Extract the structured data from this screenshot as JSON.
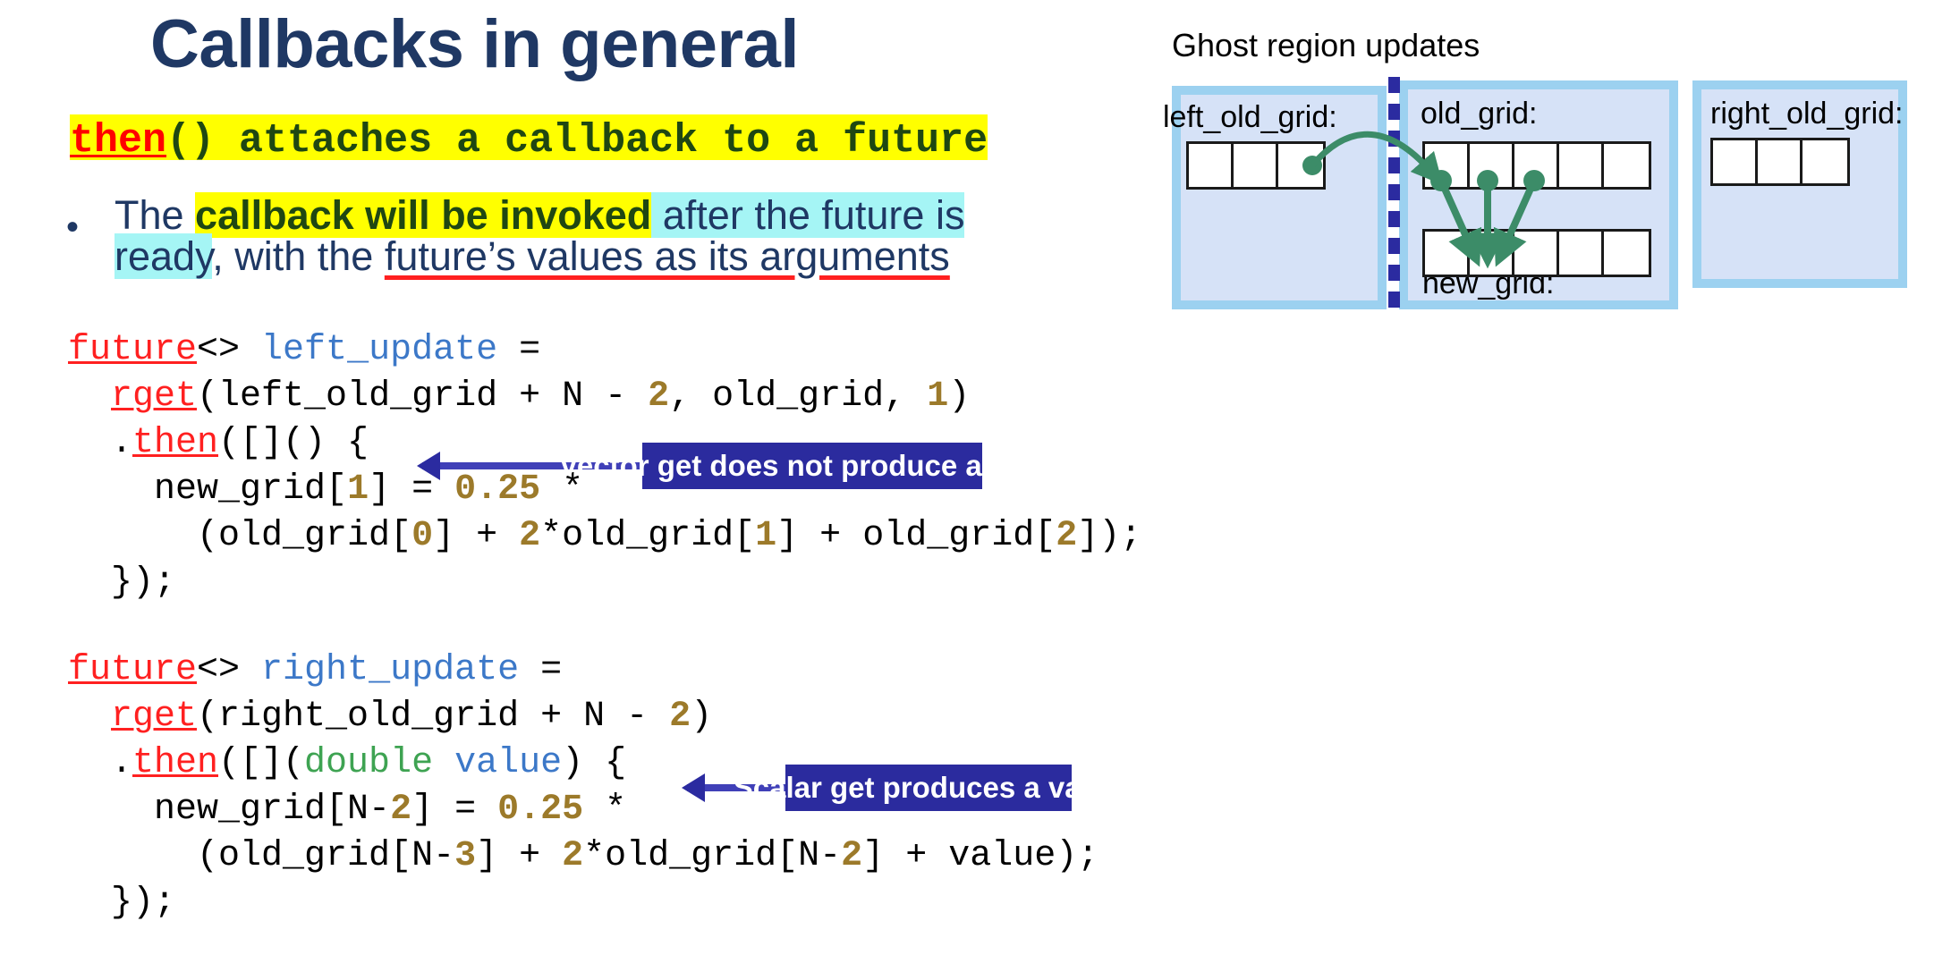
{
  "slide": {
    "title": "Callbacks in general"
  },
  "lead": {
    "keyword": "then",
    "rest": "() attaches a callback to a future"
  },
  "bullet": {
    "marker": "•",
    "line1_a": "The ",
    "line1_b": "callback will be invoked",
    "line1_c": " after the future is",
    "line2_a": "ready",
    "line2_b": ", with the ",
    "line2_c": "future’s values as its arguments"
  },
  "code_left": {
    "lines": [
      [
        {
          "t": "future",
          "c": "kw"
        },
        {
          "t": "<> ",
          "c": "op"
        },
        {
          "t": "left_update",
          "c": "var"
        },
        {
          "t": " =",
          "c": "op"
        }
      ],
      [
        {
          "t": "  ",
          "c": "op"
        },
        {
          "t": "rget",
          "c": "kw"
        },
        {
          "t": "(left_old_grid + N - ",
          "c": "op"
        },
        {
          "t": "2",
          "c": "num"
        },
        {
          "t": ", old_grid, ",
          "c": "op"
        },
        {
          "t": "1",
          "c": "num"
        },
        {
          "t": ")",
          "c": "op"
        }
      ],
      [
        {
          "t": "  .",
          "c": "op"
        },
        {
          "t": "then",
          "c": "kw"
        },
        {
          "t": "([]() {",
          "c": "op"
        }
      ],
      [
        {
          "t": "    new_grid[",
          "c": "op"
        },
        {
          "t": "1",
          "c": "num"
        },
        {
          "t": "] = ",
          "c": "op"
        },
        {
          "t": "0.25",
          "c": "num"
        },
        {
          "t": " *",
          "c": "op"
        }
      ],
      [
        {
          "t": "      (old_grid[",
          "c": "op"
        },
        {
          "t": "0",
          "c": "num"
        },
        {
          "t": "] + ",
          "c": "op"
        },
        {
          "t": "2",
          "c": "num"
        },
        {
          "t": "*old_grid[",
          "c": "op"
        },
        {
          "t": "1",
          "c": "num"
        },
        {
          "t": "] + old_grid[",
          "c": "op"
        },
        {
          "t": "2",
          "c": "num"
        },
        {
          "t": "]);",
          "c": "op"
        }
      ],
      [
        {
          "t": "  });",
          "c": "op"
        }
      ]
    ]
  },
  "code_right": {
    "lines": [
      [
        {
          "t": "future",
          "c": "kw"
        },
        {
          "t": "<> ",
          "c": "op"
        },
        {
          "t": "right_update",
          "c": "var"
        },
        {
          "t": " =",
          "c": "op"
        }
      ],
      [
        {
          "t": "  ",
          "c": "op"
        },
        {
          "t": "rget",
          "c": "kw"
        },
        {
          "t": "(right_old_grid + N - ",
          "c": "op"
        },
        {
          "t": "2",
          "c": "num"
        },
        {
          "t": ")",
          "c": "op"
        }
      ],
      [
        {
          "t": "  .",
          "c": "op"
        },
        {
          "t": "then",
          "c": "kw"
        },
        {
          "t": "([](",
          "c": "op"
        },
        {
          "t": "double",
          "c": "type"
        },
        {
          "t": " ",
          "c": "op"
        },
        {
          "t": "value",
          "c": "var"
        },
        {
          "t": ") {",
          "c": "op"
        }
      ],
      [
        {
          "t": "    new_grid[N-",
          "c": "op"
        },
        {
          "t": "2",
          "c": "num"
        },
        {
          "t": "] = ",
          "c": "op"
        },
        {
          "t": "0.25",
          "c": "num"
        },
        {
          "t": " *",
          "c": "op"
        }
      ],
      [
        {
          "t": "      (old_grid[N-",
          "c": "op"
        },
        {
          "t": "3",
          "c": "num"
        },
        {
          "t": "] + ",
          "c": "op"
        },
        {
          "t": "2",
          "c": "num"
        },
        {
          "t": "*old_grid[N-",
          "c": "op"
        },
        {
          "t": "2",
          "c": "num"
        },
        {
          "t": "] + value);",
          "c": "op"
        }
      ],
      [
        {
          "t": "  });",
          "c": "op"
        }
      ]
    ]
  },
  "callouts": {
    "vector": "Vector get does not produce a value",
    "scalar": "Scalar get produces a value"
  },
  "diagram": {
    "caption": "Ghost region updates",
    "labels": {
      "left_old_grid": "left_old_grid:",
      "old_grid": "old_grid:",
      "right_old_grid": "right_old_grid:",
      "new_grid": "new_grid:"
    },
    "cells": {
      "left_old_grid": 3,
      "old_grid": 5,
      "new_grid": 5,
      "right_old_grid": 3
    }
  },
  "colors": {
    "title": "#1F3864",
    "highlight_yellow": "#FFFF00",
    "highlight_cyan": "#A5F5F5",
    "keyword_red": "#FF2020",
    "code_var_blue": "#3C78C8",
    "code_num_gold": "#9C7A2A",
    "code_type_green": "#3EA352",
    "callout_bg": "#2B2B9E",
    "panel_outer": "#9CD1F0",
    "panel_inner": "#D6E2F7",
    "arrow_green": "#3C8C68",
    "divider_blue": "#2B2BA0"
  }
}
